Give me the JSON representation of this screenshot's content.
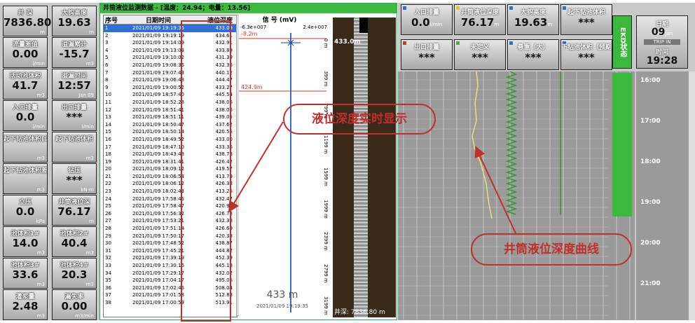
{
  "left_tiles": [
    {
      "label": "井 深",
      "value": "7836.80",
      "unit": "m"
    },
    {
      "label": "大钩高度",
      "value": "19.63",
      "unit": "m"
    },
    {
      "label": "流量差值",
      "value": "0.00",
      "unit": "l/min"
    },
    {
      "label": "溢漏累计",
      "value": "-15.7",
      "unit": "m3"
    },
    {
      "label": "活动池体积",
      "value": "41.7",
      "unit": "m3"
    },
    {
      "label": "溢漏时间",
      "value": "12:57",
      "unit": "Jan 09"
    },
    {
      "label": "入口排量",
      "value": "0.0",
      "unit": "l/min"
    },
    {
      "label": "出口排量",
      "value": "***",
      "unit": "l/min"
    },
    {
      "label": "起下钻池体积(计算)",
      "value": "",
      "unit": "m3"
    },
    {
      "label": "起下钻池体积",
      "value": "",
      "unit": "m3"
    },
    {
      "label": "起下钻池体积差值",
      "value": "",
      "unit": "m3"
    },
    {
      "label": "钻压",
      "value": "***",
      "unit": "kN-m"
    },
    {
      "label": "立压",
      "value": "0.0",
      "unit": "kPa"
    },
    {
      "label": "井筒液位深",
      "value": "76.17",
      "unit": "m"
    },
    {
      "label": "池体积1#",
      "value": "14.0",
      "unit": "m3"
    },
    {
      "label": "池体积2#",
      "value": "40.4",
      "unit": "m3"
    },
    {
      "label": "池体积3#",
      "value": "33.6",
      "unit": "m3"
    },
    {
      "label": "池体积4#",
      "value": "20.3",
      "unit": "m3"
    },
    {
      "label": "灌浆量",
      "value": "2.48",
      "unit": "m3"
    },
    {
      "label": "漏失率",
      "value": "0.00",
      "unit": "m3/min"
    }
  ],
  "table_header": "井筒液位监测数据 - [温度：24.94；电量：13.56]",
  "table_columns": [
    "序号",
    "日期时间",
    "液位深度"
  ],
  "table_rows": [
    [
      "1",
      "2021/01/09 19:19:35",
      "433.09"
    ],
    [
      "2",
      "2021/01/09 19:19:19",
      "434.61"
    ],
    [
      "3",
      "2021/01/09 19:14:09",
      "432.91"
    ],
    [
      "4",
      "2021/01/09 19:13:03",
      "433.89"
    ],
    [
      "5",
      "2021/01/09 19:10:02",
      "431.39"
    ],
    [
      "6",
      "2021/01/09 19:08:36",
      "432.36"
    ],
    [
      "7",
      "2021/01/09 19:07:43",
      "440.12"
    ],
    [
      "8",
      "2021/01/09 19:06:48",
      "444.47"
    ],
    [
      "9",
      "2021/01/09 19:00:52",
      "433.27"
    ],
    [
      "10",
      "2021/01/09 18:57:40",
      "445.54"
    ],
    [
      "11",
      "2021/01/09 18:52:28",
      "438.06"
    ],
    [
      "12",
      "2021/01/09 18:51:41",
      "438.06"
    ],
    [
      "13",
      "2021/01/09 18:51:11",
      "439.05"
    ],
    [
      "14",
      "2021/01/09 18:50:47",
      "437.62"
    ],
    [
      "15",
      "2021/01/09 18:50:14",
      "420.55"
    ],
    [
      "16",
      "2021/01/09 18:49:52",
      "433.00"
    ],
    [
      "17",
      "2021/01/09 18:47:10",
      "433.36"
    ],
    [
      "18",
      "2021/01/09 18:43:48",
      "438.78"
    ],
    [
      "19",
      "2021/01/09 18:31:41",
      "426.42"
    ],
    [
      "20",
      "2021/01/09 18:09:12",
      "419.57"
    ],
    [
      "21",
      "2021/01/09 18:06:54",
      "413.79"
    ],
    [
      "22",
      "2021/01/09 18:06:12",
      "426.33"
    ],
    [
      "23",
      "2021/01/09 18:02:43",
      "413.26"
    ],
    [
      "24",
      "2021/01/09 17:58:45",
      "432.47"
    ],
    [
      "25",
      "2021/01/09 17:58:47",
      "420.91"
    ],
    [
      "26",
      "2021/01/09 17:56:32",
      "426.78"
    ],
    [
      "27",
      "2021/01/09 17:53:21",
      "432.38"
    ],
    [
      "28",
      "2021/01/09 17:51:14",
      "426.69"
    ],
    [
      "29",
      "2021/01/09 17:50:17",
      "420.38"
    ],
    [
      "30",
      "2021/01/09 17:48:52",
      "438.87"
    ],
    [
      "31",
      "2021/01/09 17:45:21",
      "444.82"
    ],
    [
      "32",
      "2021/01/09 17:39:19",
      "452.39"
    ],
    [
      "33",
      "2021/01/09 17:30:16",
      "445.18"
    ],
    [
      "34",
      "2021/01/09 17:29:17",
      "432.02"
    ],
    [
      "35",
      "2021/01/09 17:04:17",
      "495.06"
    ],
    [
      "36",
      "2021/01/09 17:02:45",
      "508.04"
    ],
    [
      "37",
      "2021/01/09 17:01:58",
      "512.83"
    ],
    [
      "38",
      "2021/01/09 17:00:59",
      "513.91"
    ]
  ],
  "signal_chart": {
    "title": "信 号 (mV)",
    "x_min": "-6.3e+007",
    "x_max": "2.4e+007",
    "depth_top": "-8.2m",
    "red_mark": "424.9m",
    "depth_ticks": [
      "0 m",
      "399 m",
      "799 m",
      "1199 m",
      "1599 m",
      "1999 m",
      "2399 m",
      "2799 m",
      "3199 m"
    ],
    "big_reading": "433 m",
    "timestamp": "2021/01/09 19:19:35",
    "strip_top": "433.0m",
    "strip_bottom": "井深: 7836.80 m"
  },
  "right_tiles_row1": [
    {
      "label": "入口排量",
      "value": "0.0",
      "unit": "l/min",
      "dot": "#2f6fd8"
    },
    {
      "label": "井筒液位深度",
      "value": "76.17",
      "unit": "m",
      "dot": "#e2c21a"
    },
    {
      "label": "大钩高度",
      "value": "19.63",
      "unit": "m",
      "dot": "#2f6fd8"
    },
    {
      "label": "起下钻池体积",
      "value": "***",
      "unit": "",
      "dot": "#2f6fd8"
    }
  ],
  "right_tiles_row2": [
    {
      "label": "出口排量",
      "value": "***",
      "unit": "",
      "dot": "#d23a2a"
    },
    {
      "label": "未定义",
      "value": "***",
      "unit": "",
      "dot": "#3cb83c"
    },
    {
      "label": "悬重（大）",
      "value": "***",
      "unit": "",
      "dot": "#2f6fd8"
    },
    {
      "label": "下钻池体积（预期",
      "value": "***",
      "unit": "",
      "dot": "#2f6fd8"
    }
  ],
  "ekd_label": "EKD状态",
  "date_box": {
    "label": "日期",
    "day": "09",
    "month": "Jan",
    "status": "TRIP IN",
    "time_label": "时间",
    "time": "19:28"
  },
  "time_ticks": [
    "16:00",
    "17:00",
    "18:00",
    "19:00",
    "20:00",
    "21:00"
  ],
  "callouts": {
    "realtime": "液位深度实时显示",
    "curve": "井筒液位深度曲线"
  }
}
